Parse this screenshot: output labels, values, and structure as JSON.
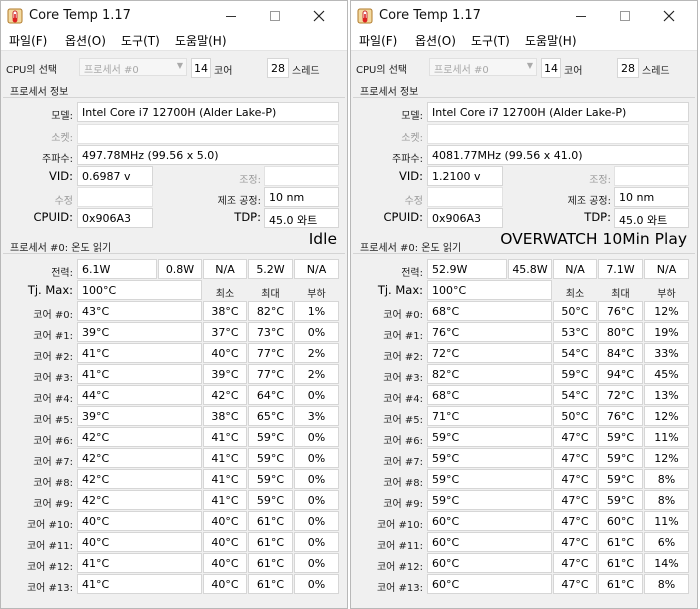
{
  "windows": [
    {
      "title": "Core Temp 1.17",
      "menu": [
        "파일(F)",
        "옵션(O)",
        "도구(T)",
        "도움말(H)"
      ],
      "cpu_select_label": "CPU의 선택",
      "cpu_select_value": "프로세서 #0",
      "cores_value": "14",
      "cores_label": "코어",
      "threads_value": "28",
      "threads_label": "스레드",
      "processor_info_title": "프로세서 정보",
      "model_label": "모델:",
      "model_value": "Intel Core i7 12700H (Alder Lake-P)",
      "socket_label": "소켓:",
      "frequency_label": "주파수:",
      "frequency_value": "497.78MHz (99.56 x 5.0)",
      "vid_label": "VID:",
      "vid_value": "0.6987 v",
      "revision_label": "조정:",
      "stepping_label": "수정",
      "lithography_label": "제조 공정:",
      "lithography_value": "10 nm",
      "cpuid_label": "CPUID:",
      "cpuid_value": "0x906A3",
      "tdp_label": "TDP:",
      "tdp_value": "45.0 와트",
      "temp_section_title": "프로세서 #0: 온도 읽기",
      "annotation": "Idle",
      "power_label": "전력:",
      "power_values": [
        "6.1W",
        "0.8W",
        "N/A",
        "5.2W",
        "N/A"
      ],
      "tjmax_label": "Tj. Max:",
      "tjmax_value": "100°C",
      "col_min": "최소",
      "col_max": "최대",
      "col_load": "부하",
      "cores": [
        {
          "label": "코어 #0:",
          "temp": "43°C",
          "min": "38°C",
          "max": "82°C",
          "load": "1%"
        },
        {
          "label": "코어 #1:",
          "temp": "39°C",
          "min": "37°C",
          "max": "73°C",
          "load": "0%"
        },
        {
          "label": "코어 #2:",
          "temp": "41°C",
          "min": "40°C",
          "max": "77°C",
          "load": "2%"
        },
        {
          "label": "코어 #3:",
          "temp": "41°C",
          "min": "39°C",
          "max": "77°C",
          "load": "2%"
        },
        {
          "label": "코어 #4:",
          "temp": "44°C",
          "min": "42°C",
          "max": "64°C",
          "load": "0%"
        },
        {
          "label": "코어 #5:",
          "temp": "39°C",
          "min": "38°C",
          "max": "65°C",
          "load": "3%"
        },
        {
          "label": "코어 #6:",
          "temp": "42°C",
          "min": "41°C",
          "max": "59°C",
          "load": "0%"
        },
        {
          "label": "코어 #7:",
          "temp": "42°C",
          "min": "41°C",
          "max": "59°C",
          "load": "0%"
        },
        {
          "label": "코어 #8:",
          "temp": "42°C",
          "min": "41°C",
          "max": "59°C",
          "load": "0%"
        },
        {
          "label": "코어 #9:",
          "temp": "42°C",
          "min": "41°C",
          "max": "59°C",
          "load": "0%"
        },
        {
          "label": "코어 #10:",
          "temp": "40°C",
          "min": "40°C",
          "max": "61°C",
          "load": "0%"
        },
        {
          "label": "코어 #11:",
          "temp": "40°C",
          "min": "40°C",
          "max": "61°C",
          "load": "0%"
        },
        {
          "label": "코어 #12:",
          "temp": "41°C",
          "min": "40°C",
          "max": "61°C",
          "load": "0%"
        },
        {
          "label": "코어 #13:",
          "temp": "41°C",
          "min": "40°C",
          "max": "61°C",
          "load": "0%"
        }
      ]
    },
    {
      "title": "Core Temp 1.17",
      "menu": [
        "파일(F)",
        "옵션(O)",
        "도구(T)",
        "도움말(H)"
      ],
      "cpu_select_label": "CPU의 선택",
      "cpu_select_value": "프로세서 #0",
      "cores_value": "14",
      "cores_label": "코어",
      "threads_value": "28",
      "threads_label": "스레드",
      "processor_info_title": "프로세서 정보",
      "model_label": "모델:",
      "model_value": "Intel Core i7 12700H (Alder Lake-P)",
      "socket_label": "소켓:",
      "frequency_label": "주파수:",
      "frequency_value": "4081.77MHz (99.56 x 41.0)",
      "vid_label": "VID:",
      "vid_value": "1.2100 v",
      "revision_label": "조정:",
      "stepping_label": "수정",
      "lithography_label": "제조 공정:",
      "lithography_value": "10 nm",
      "cpuid_label": "CPUID:",
      "cpuid_value": "0x906A3",
      "tdp_label": "TDP:",
      "tdp_value": "45.0 와트",
      "temp_section_title": "프로세서 #0: 온도 읽기",
      "annotation": "OVERWATCH 10Min Play",
      "power_label": "전력:",
      "power_values": [
        "52.9W",
        "45.8W",
        "N/A",
        "7.1W",
        "N/A"
      ],
      "tjmax_label": "Tj. Max:",
      "tjmax_value": "100°C",
      "col_min": "최소",
      "col_max": "최대",
      "col_load": "부하",
      "cores": [
        {
          "label": "코어 #0:",
          "temp": "68°C",
          "min": "50°C",
          "max": "76°C",
          "load": "12%"
        },
        {
          "label": "코어 #1:",
          "temp": "76°C",
          "min": "53°C",
          "max": "80°C",
          "load": "19%"
        },
        {
          "label": "코어 #2:",
          "temp": "72°C",
          "min": "54°C",
          "max": "84°C",
          "load": "33%"
        },
        {
          "label": "코어 #3:",
          "temp": "82°C",
          "min": "59°C",
          "max": "94°C",
          "load": "45%"
        },
        {
          "label": "코어 #4:",
          "temp": "68°C",
          "min": "54°C",
          "max": "72°C",
          "load": "13%"
        },
        {
          "label": "코어 #5:",
          "temp": "71°C",
          "min": "50°C",
          "max": "76°C",
          "load": "12%"
        },
        {
          "label": "코어 #6:",
          "temp": "59°C",
          "min": "47°C",
          "max": "59°C",
          "load": "11%"
        },
        {
          "label": "코어 #7:",
          "temp": "59°C",
          "min": "47°C",
          "max": "59°C",
          "load": "12%"
        },
        {
          "label": "코어 #8:",
          "temp": "59°C",
          "min": "47°C",
          "max": "59°C",
          "load": "8%"
        },
        {
          "label": "코어 #9:",
          "temp": "59°C",
          "min": "47°C",
          "max": "59°C",
          "load": "8%"
        },
        {
          "label": "코어 #10:",
          "temp": "60°C",
          "min": "47°C",
          "max": "60°C",
          "load": "11%"
        },
        {
          "label": "코어 #11:",
          "temp": "60°C",
          "min": "47°C",
          "max": "61°C",
          "load": "6%"
        },
        {
          "label": "코어 #12:",
          "temp": "60°C",
          "min": "47°C",
          "max": "61°C",
          "load": "14%"
        },
        {
          "label": "코어 #13:",
          "temp": "60°C",
          "min": "47°C",
          "max": "61°C",
          "load": "8%"
        }
      ]
    }
  ]
}
